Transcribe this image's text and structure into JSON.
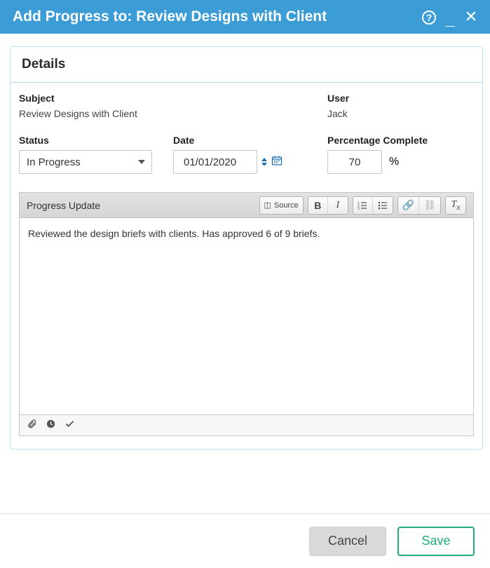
{
  "titlebar": {
    "title": "Add Progress to: Review Designs with Client"
  },
  "panel": {
    "header": "Details",
    "subject_label": "Subject",
    "subject_value": "Review Designs with Client",
    "user_label": "User",
    "user_value": "Jack",
    "status_label": "Status",
    "status_value": "In Progress",
    "date_label": "Date",
    "date_value": "01/01/2020",
    "pct_label": "Percentage Complete",
    "pct_value": "70",
    "pct_unit": "%"
  },
  "editor": {
    "title": "Progress Update",
    "source_label": "Source",
    "content": "Reviewed the design briefs with clients. Has approved 6 of 9 briefs."
  },
  "buttons": {
    "cancel": "Cancel",
    "save": "Save"
  }
}
